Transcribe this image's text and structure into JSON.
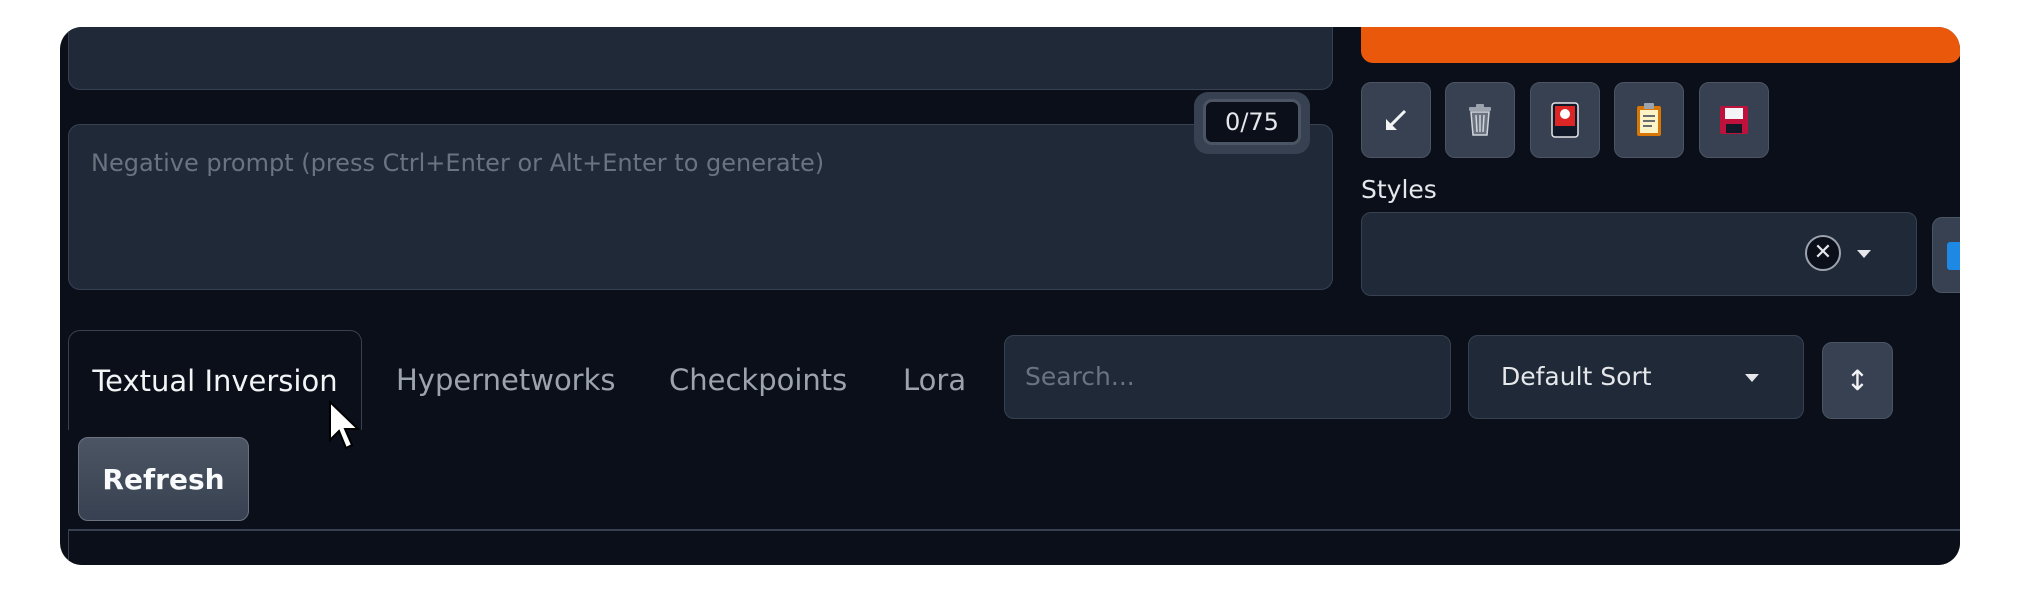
{
  "prompt": {
    "negative_placeholder": "Negative prompt (press Ctrl+Enter or Alt+Enter to generate)",
    "token_counter": "0/75"
  },
  "toolbar": {
    "buttons": [
      {
        "icon": "arrow-down-left-icon"
      },
      {
        "icon": "trash-icon"
      },
      {
        "icon": "card-icon"
      },
      {
        "icon": "clipboard-icon"
      },
      {
        "icon": "save-icon"
      }
    ],
    "accent": "#ea580c"
  },
  "styles": {
    "label": "Styles",
    "clear_symbol": "✕"
  },
  "tabs": [
    {
      "label": "Textual Inversion",
      "active": true
    },
    {
      "label": "Hypernetworks",
      "active": false
    },
    {
      "label": "Checkpoints",
      "active": false
    },
    {
      "label": "Lora",
      "active": false
    }
  ],
  "extra_networks": {
    "search_placeholder": "Search...",
    "sort_value": "Default Sort",
    "sort_direction_symbol": "↕",
    "refresh_label": "Refresh"
  }
}
